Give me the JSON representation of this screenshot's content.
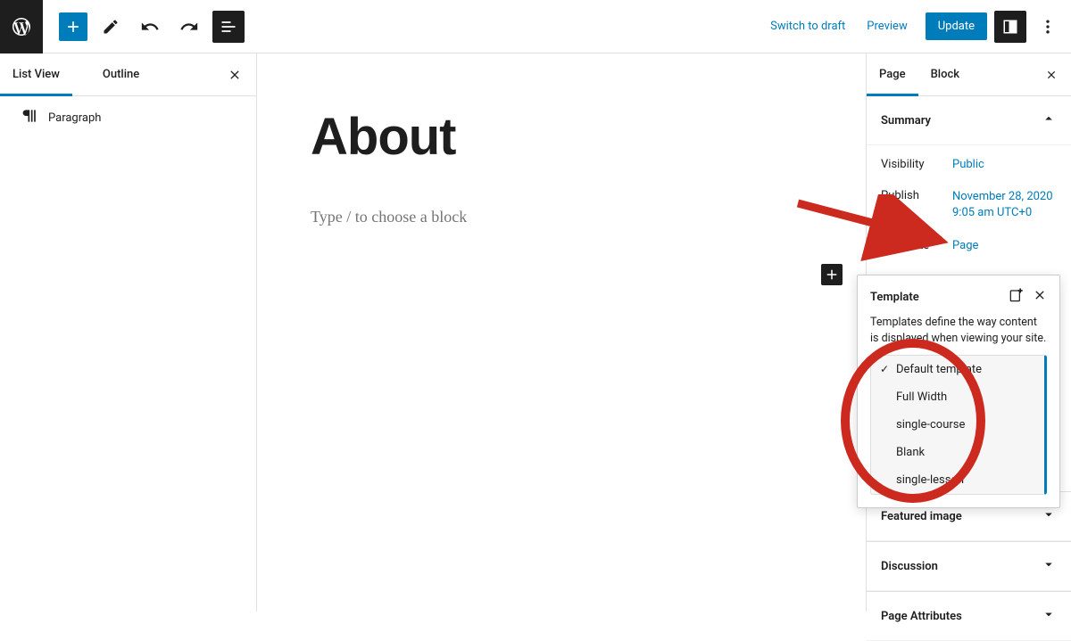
{
  "topbar": {
    "switch_to_draft": "Switch to draft",
    "preview": "Preview",
    "update": "Update"
  },
  "left_panel": {
    "tab_list_view": "List View",
    "tab_outline": "Outline",
    "items": [
      {
        "label": "Paragraph"
      }
    ]
  },
  "canvas": {
    "title": "About",
    "placeholder": "Type / to choose a block"
  },
  "right_panel": {
    "tab_page": "Page",
    "tab_block": "Block",
    "sections": {
      "summary": {
        "title": "Summary",
        "visibility_label": "Visibility",
        "visibility_value": "Public",
        "publish_label": "Publish",
        "publish_value_line1": "November 28, 2020",
        "publish_value_line2": "9:05 am UTC+0",
        "template_label": "Template",
        "template_value": "Page"
      },
      "featured_image": "Featured image",
      "discussion": "Discussion",
      "page_attributes": "Page Attributes"
    }
  },
  "template_popover": {
    "title": "Template",
    "description": "Templates define the way content is displayed when viewing your site.",
    "options": [
      {
        "label": "Default template",
        "checked": true
      },
      {
        "label": "Full Width",
        "checked": false
      },
      {
        "label": "single-course",
        "checked": false
      },
      {
        "label": "Blank",
        "checked": false
      },
      {
        "label": "single-lesson",
        "checked": false
      }
    ]
  }
}
